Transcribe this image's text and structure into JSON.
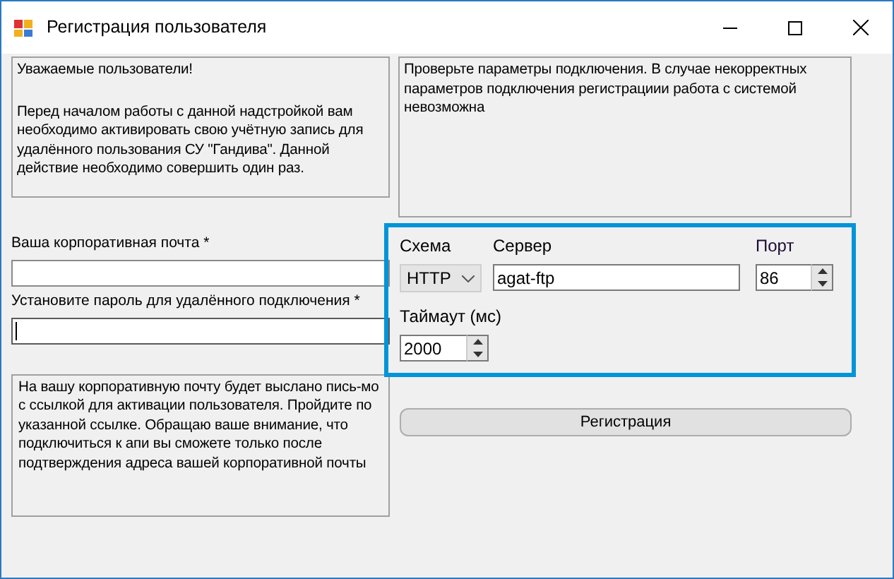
{
  "window": {
    "title": "Регистрация пользователя"
  },
  "welcome_notice": [
    "Уважаемые пользователи!",
    "Перед началом работы с данной надстройкой вам необходимо активировать свою учётную запись для удалённого пользования СУ \"Гандива\". Данной действие необходимо совершить один раз."
  ],
  "connection_notice": "Проверьте параметры подключения. В случае некорректных параметров подключения регистрациии работа с системой невозможна",
  "fields": [
    {
      "label": "Ваша корпоративная почта *",
      "focused": false
    },
    {
      "label": "Установите пароль для удалённого подключения *",
      "focused": true
    }
  ],
  "activation_notice": "На вашу корпоративную почту будет выслано пись-мо с ссылкой для активации пользователя. Пройдите по указанной ссылке. Обращаю ваше внимание, что подключиться к апи вы сможете только после подтверждения адреса вашей корпоративной почты",
  "connection": {
    "scheme": {
      "label": "Схема",
      "value": "HTTP"
    },
    "server": {
      "label": "Сервер",
      "value": "agat-ftp"
    },
    "port": {
      "label": "Порт",
      "value": "86"
    },
    "timeout": {
      "label": "Таймаут (мс)",
      "value": "2000"
    }
  },
  "buttons": [
    "Регистрация"
  ]
}
